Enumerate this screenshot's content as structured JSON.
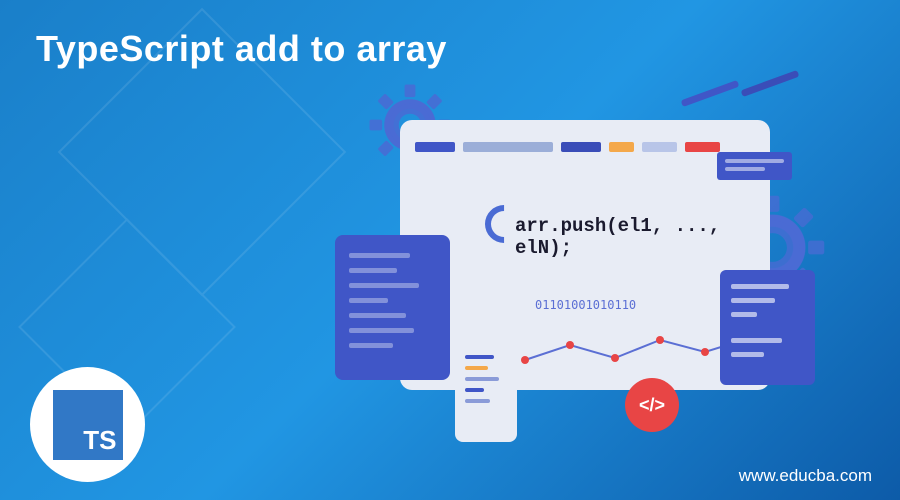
{
  "title": "TypeScript add to array",
  "code_snippet": "arr.push(el1, ..., elN);",
  "binary": "01101001010110",
  "code_symbol": "</>",
  "logo_text": "TS",
  "website": "www.educba.com",
  "colors": {
    "blue": "#4056c7",
    "red": "#e84545",
    "orange": "#f4a84a",
    "light": "#e8ecf5"
  }
}
